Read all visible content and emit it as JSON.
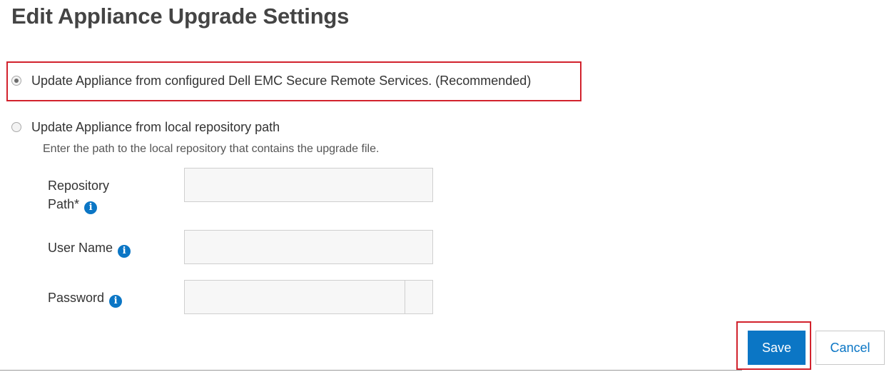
{
  "page": {
    "title": "Edit Appliance Upgrade Settings"
  },
  "options": [
    {
      "label": "Update Appliance from configured Dell EMC Secure Remote Services. (Recommended)",
      "selected": true
    },
    {
      "label": "Update Appliance from local repository path",
      "selected": false
    }
  ],
  "local_repo": {
    "hint": "Enter the path to the local repository that contains the upgrade file.",
    "fields": {
      "repository_path": {
        "label_line1": "Repository",
        "label_line2": "Path*",
        "value": ""
      },
      "user_name": {
        "label": "User Name",
        "value": ""
      },
      "password": {
        "label": "Password",
        "value": ""
      }
    }
  },
  "buttons": {
    "save": "Save",
    "cancel": "Cancel"
  },
  "icons": {
    "info": "info-icon",
    "info_glyph": "i"
  },
  "colors": {
    "accent": "#0b76c5",
    "highlight": "#d2222d",
    "title": "#444444",
    "input_bg": "#f7f7f7"
  }
}
